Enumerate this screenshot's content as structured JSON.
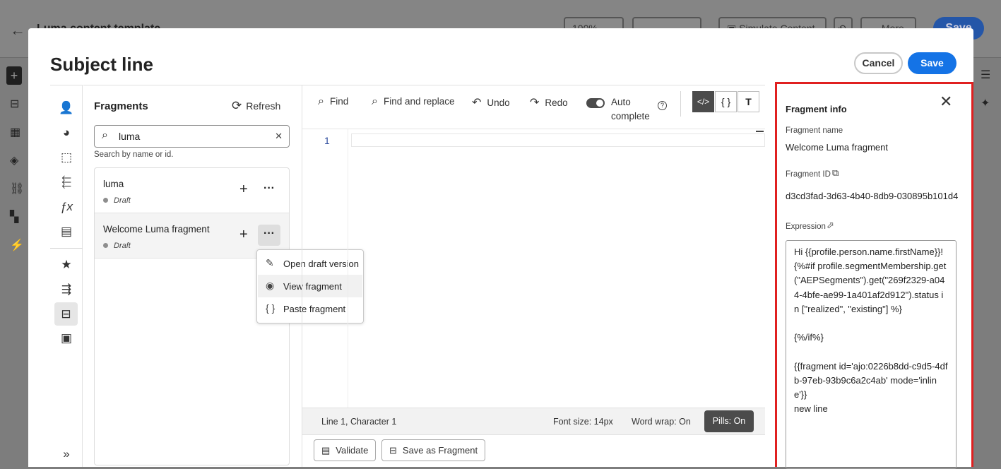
{
  "background": {
    "title": "Luma content template",
    "zoom": "100%",
    "simulate": "Simulate Content",
    "more": "More",
    "save": "Save"
  },
  "modal": {
    "title": "Subject line",
    "cancel": "Cancel",
    "save": "Save"
  },
  "rail": [
    "profile-icon",
    "audience-icon",
    "context-icon",
    "offer-icon",
    "function-icon",
    "helper-icon",
    "favorites-icon",
    "journey-icon",
    "fragment-icon",
    "template-icon"
  ],
  "fragments": {
    "title": "Fragments",
    "refresh": "Refresh",
    "search_value": "luma",
    "search_hint": "Search by name or id.",
    "items": [
      {
        "name": "luma",
        "status": "Draft"
      },
      {
        "name": "Welcome Luma fragment",
        "status": "Draft"
      }
    ]
  },
  "context_menu": {
    "items": [
      {
        "label": "Open draft version",
        "icon": "edit-icon"
      },
      {
        "label": "View fragment",
        "icon": "eye-icon"
      },
      {
        "label": "Paste fragment",
        "icon": "braces-icon"
      }
    ]
  },
  "toolbar": {
    "find": "Find",
    "find_replace": "Find and replace",
    "undo": "Undo",
    "redo": "Redo",
    "auto_line1": "Auto",
    "auto_line2": "complete",
    "help": "?",
    "auto_complete_on": true
  },
  "editor": {
    "line_number": "1",
    "status": {
      "position": "Line 1, Character 1",
      "font_size": "Font size: 14px",
      "word_wrap": "Word wrap: On",
      "pills": "Pills: On"
    },
    "validate": "Validate",
    "save_fragment": "Save as Fragment"
  },
  "info": {
    "title": "Fragment info",
    "name_label": "Fragment name",
    "name_value": "Welcome Luma fragment",
    "id_label": "Fragment ID",
    "id_value": "d3cd3fad-3d63-4b40-8db9-030895b101d4",
    "expression_label": "Expression",
    "expression": "Hi {{profile.person.name.firstName}}!\n{%#if profile.segmentMembership.get(\"AEPSegments\").get(\"269f2329-a044-4bfe-ae99-1a401af2d912\").status in [\"realized\", \"existing\"] %}\n\n{%/if%}\n\n{{fragment id='ajo:0226b8dd-c9d5-4dfb-97eb-93b9c6a2c4ab' mode='inline'}}\nnew line"
  },
  "colors": {
    "accent": "#1473e6",
    "highlight_border": "#e02020",
    "dark_toggle": "#4b4b4b"
  }
}
